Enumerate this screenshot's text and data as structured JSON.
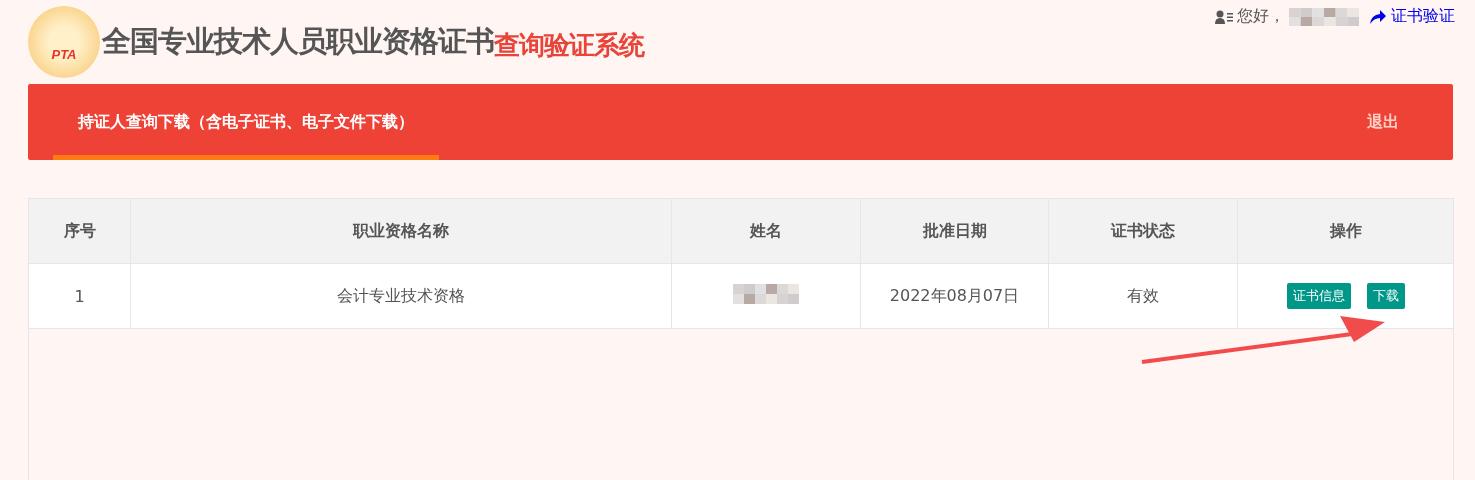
{
  "header": {
    "logo_text": "PTA",
    "title": "全国专业技术人员职业资格证书",
    "subtitle": "查询验证系统"
  },
  "user_bar": {
    "greeting": "您好，",
    "verify_link": "证书验证"
  },
  "nav": {
    "tabs": [
      {
        "label": "持证人查询下载（含电子证书、电子文件下载）",
        "selected": true
      }
    ],
    "logout": "退出"
  },
  "table": {
    "columns": [
      "序号",
      "职业资格名称",
      "姓名",
      "批准日期",
      "证书状态",
      "操作"
    ],
    "rows": [
      {
        "index": "1",
        "qualification": "会计专业技术资格",
        "date": "2022年08月07日",
        "status": "有效",
        "actions": [
          "证书信息",
          "下载"
        ]
      }
    ]
  }
}
